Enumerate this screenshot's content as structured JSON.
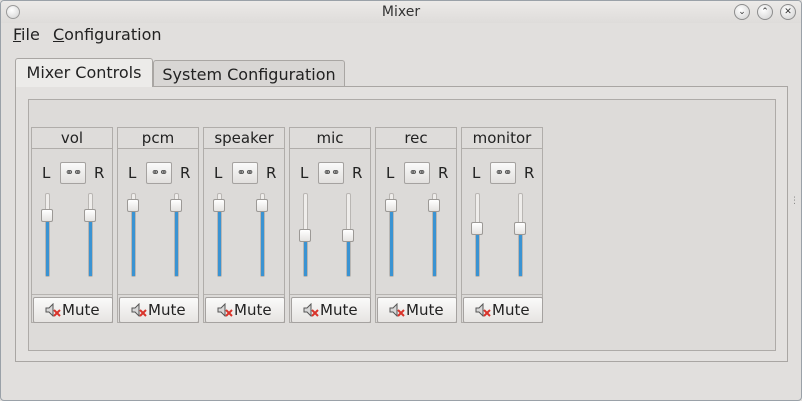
{
  "window": {
    "title": "Mixer"
  },
  "titlebar_buttons": [
    "minimize",
    "maximize",
    "close"
  ],
  "menubar": {
    "file": {
      "mnemonic": "F",
      "rest": "ile"
    },
    "configuration": {
      "mnemonic": "C",
      "rest": "onfiguration"
    }
  },
  "tabs": [
    {
      "label": "Mixer Controls",
      "active": true
    },
    {
      "label": "System Configuration",
      "active": false
    }
  ],
  "channel_common": {
    "left": "L",
    "right": "R",
    "mute": "Mute"
  },
  "channels": [
    {
      "name": "vol",
      "left_level": 0.78,
      "right_level": 0.78
    },
    {
      "name": "pcm",
      "left_level": 0.92,
      "right_level": 0.92
    },
    {
      "name": "speaker",
      "left_level": 0.92,
      "right_level": 0.92
    },
    {
      "name": "mic",
      "left_level": 0.49,
      "right_level": 0.49
    },
    {
      "name": "rec",
      "left_level": 0.92,
      "right_level": 0.92
    },
    {
      "name": "monitor",
      "left_level": 0.59,
      "right_level": 0.59
    }
  ],
  "colors": {
    "slider_fill": "#3a93d2",
    "mute_x": "#d9342b"
  },
  "icons": {
    "link": "chain-link-icon",
    "mute": "speaker-muted-icon"
  }
}
